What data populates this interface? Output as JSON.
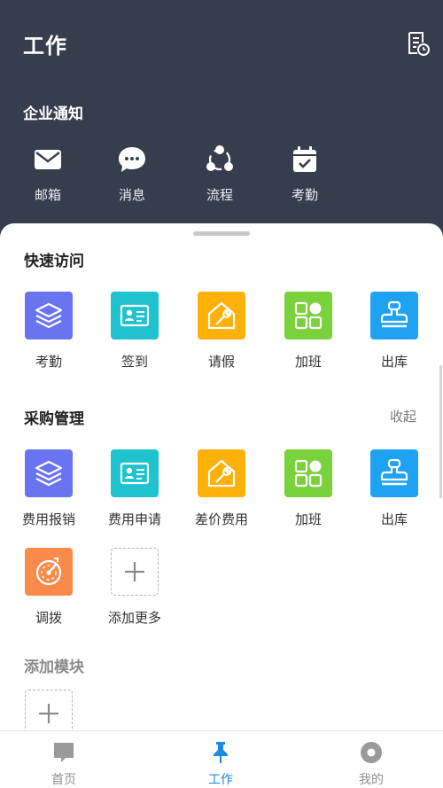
{
  "header": {
    "title": "工作",
    "action_icon": "document-clock-icon"
  },
  "notice": {
    "title": "企业通知",
    "items": [
      {
        "label": "邮箱",
        "icon": "mail-icon"
      },
      {
        "label": "消息",
        "icon": "chat-bubble-icon"
      },
      {
        "label": "流程",
        "icon": "workflow-icon"
      },
      {
        "label": "考勤",
        "icon": "calendar-check-icon"
      }
    ]
  },
  "quick": {
    "title": "快速访问",
    "items": [
      {
        "label": "考勤",
        "icon": "layers-icon",
        "color": "#6a73f0"
      },
      {
        "label": "签到",
        "icon": "id-card-icon",
        "color": "#1fc2cf"
      },
      {
        "label": "请假",
        "icon": "house-wrench-icon",
        "color": "#ffb10a"
      },
      {
        "label": "加班",
        "icon": "grid-apps-icon",
        "color": "#79d13c"
      },
      {
        "label": "出库",
        "icon": "stamp-icon",
        "color": "#1ea3f2"
      }
    ]
  },
  "purchase": {
    "title": "采购管理",
    "collapse_label": "收起",
    "items": [
      {
        "label": "费用报销",
        "icon": "layers-icon",
        "color": "#6a73f0"
      },
      {
        "label": "费用申请",
        "icon": "id-card-icon",
        "color": "#1fc2cf"
      },
      {
        "label": "差价费用",
        "icon": "house-wrench-icon",
        "color": "#ffb10a"
      },
      {
        "label": "加班",
        "icon": "grid-apps-icon",
        "color": "#79d13c"
      },
      {
        "label": "出库",
        "icon": "stamp-icon",
        "color": "#1ea3f2"
      },
      {
        "label": "调拨",
        "icon": "compass-icon",
        "color": "#f98a4a"
      }
    ],
    "add_more_label": "添加更多"
  },
  "modules": {
    "title": "添加模块"
  },
  "tabbar": {
    "items": [
      {
        "label": "首页",
        "icon": "home-bubble-icon",
        "active": false
      },
      {
        "label": "工作",
        "icon": "pushpin-icon",
        "active": true
      },
      {
        "label": "我的",
        "icon": "profile-circle-icon",
        "active": false
      }
    ]
  },
  "colors": {
    "header_bg": "#363e4e",
    "active": "#1e88e5"
  }
}
